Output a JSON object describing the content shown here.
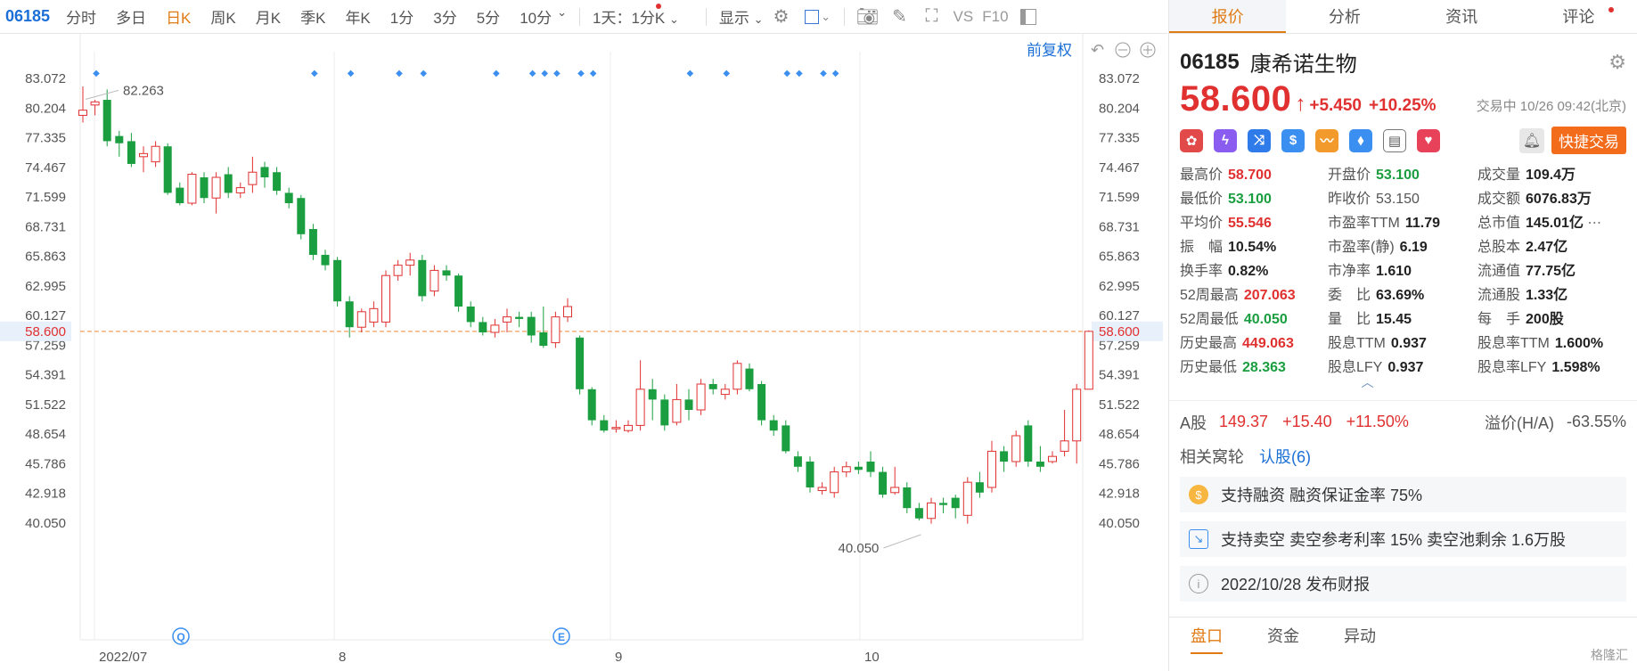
{
  "toolbar": {
    "code": "06185",
    "items": [
      {
        "label": "分时",
        "active": false
      },
      {
        "label": "多日",
        "active": false
      },
      {
        "label": "日K",
        "active": true
      },
      {
        "label": "周K",
        "active": false
      },
      {
        "label": "月K",
        "active": false
      },
      {
        "label": "季K",
        "active": false
      },
      {
        "label": "年K",
        "active": false
      },
      {
        "label": "1分",
        "active": false
      },
      {
        "label": "3分",
        "active": false
      },
      {
        "label": "5分",
        "active": false
      },
      {
        "label": "10分",
        "active": false
      }
    ],
    "period_select": "1天：1分K",
    "display_label": "显示",
    "vs_label": "VS",
    "f10_label": "F10",
    "restore_label": "前复权"
  },
  "chart_data": {
    "type": "candlestick",
    "y_ticks": [
      "83.072",
      "80.204",
      "77.335",
      "74.467",
      "71.599",
      "68.731",
      "65.863",
      "62.995",
      "60.127",
      "57.259",
      "54.391",
      "51.522",
      "48.654",
      "45.786",
      "42.918",
      "40.050"
    ],
    "current_price_label": "58.600",
    "high_label": "82.263",
    "low_label": "40.050",
    "x_labels": [
      "2022/07",
      "8",
      "9",
      "10"
    ],
    "event_markers": [
      "Q",
      "E"
    ],
    "candles": [
      [
        79.5,
        80.0,
        78.8,
        82.3
      ],
      [
        80.5,
        80.8,
        79.5,
        81.0
      ],
      [
        81.0,
        77.0,
        76.5,
        82.0
      ],
      [
        77.5,
        76.8,
        75.5,
        78.0
      ],
      [
        77.0,
        74.8,
        74.5,
        77.8
      ],
      [
        75.5,
        75.8,
        74.0,
        76.5
      ],
      [
        75.0,
        76.5,
        74.5,
        77.0
      ],
      [
        76.5,
        72.0,
        71.8,
        76.8
      ],
      [
        72.5,
        71.0,
        70.8,
        73.0
      ],
      [
        71.0,
        73.8,
        70.8,
        74.0
      ],
      [
        73.5,
        71.5,
        71.0,
        74.0
      ],
      [
        71.5,
        73.5,
        70.0,
        74.0
      ],
      [
        73.8,
        72.0,
        71.5,
        74.5
      ],
      [
        72.0,
        72.5,
        71.5,
        73.0
      ],
      [
        72.8,
        74.0,
        72.0,
        75.5
      ],
      [
        74.5,
        73.5,
        72.5,
        75.0
      ],
      [
        74.0,
        72.2,
        71.8,
        74.5
      ],
      [
        72.0,
        71.0,
        70.5,
        72.5
      ],
      [
        71.5,
        68.0,
        67.5,
        71.8
      ],
      [
        68.5,
        66.0,
        65.5,
        69.0
      ],
      [
        66.0,
        65.0,
        64.5,
        66.5
      ],
      [
        65.5,
        61.5,
        61.0,
        65.8
      ],
      [
        61.5,
        59.0,
        58.0,
        62.0
      ],
      [
        59.0,
        60.5,
        58.5,
        60.8
      ],
      [
        59.5,
        60.8,
        59.0,
        61.5
      ],
      [
        59.5,
        64.0,
        59.0,
        64.5
      ],
      [
        64.0,
        65.0,
        63.5,
        65.5
      ],
      [
        65.0,
        65.5,
        64.0,
        66.2
      ],
      [
        65.5,
        62.0,
        61.5,
        66.0
      ],
      [
        62.5,
        64.5,
        62.0,
        65.0
      ],
      [
        64.5,
        64.0,
        63.5,
        65.0
      ],
      [
        64.0,
        61.0,
        60.5,
        64.2
      ],
      [
        61.0,
        59.5,
        59.0,
        61.5
      ],
      [
        59.5,
        58.5,
        58.2,
        60.0
      ],
      [
        58.5,
        59.2,
        58.0,
        59.8
      ],
      [
        59.5,
        60.0,
        58.5,
        60.8
      ],
      [
        60.0,
        59.8,
        59.0,
        60.5
      ],
      [
        60.0,
        58.2,
        57.5,
        60.5
      ],
      [
        58.5,
        57.2,
        57.0,
        61.0
      ],
      [
        57.5,
        60.0,
        57.0,
        60.5
      ],
      [
        60.0,
        61.0,
        59.5,
        61.8
      ],
      [
        58.0,
        53.0,
        52.5,
        58.2
      ],
      [
        53.0,
        50.0,
        49.5,
        53.2
      ],
      [
        50.0,
        49.0,
        48.8,
        50.5
      ],
      [
        49.2,
        49.3,
        48.8,
        50.0
      ],
      [
        49.0,
        49.5,
        48.8,
        50.0
      ],
      [
        49.5,
        53.0,
        49.0,
        55.8
      ],
      [
        53.0,
        52.0,
        50.0,
        54.0
      ],
      [
        52.0,
        49.5,
        49.0,
        52.5
      ],
      [
        49.8,
        52.0,
        49.5,
        53.5
      ],
      [
        52.0,
        51.0,
        50.0,
        53.0
      ],
      [
        51.0,
        53.5,
        50.5,
        54.0
      ],
      [
        53.5,
        53.0,
        52.5,
        54.0
      ],
      [
        52.5,
        53.0,
        52.0,
        53.5
      ],
      [
        53.0,
        55.5,
        52.5,
        55.8
      ],
      [
        55.0,
        53.0,
        52.8,
        55.5
      ],
      [
        53.5,
        50.0,
        49.5,
        53.8
      ],
      [
        50.0,
        49.0,
        48.5,
        50.5
      ],
      [
        49.5,
        47.0,
        46.8,
        50.0
      ],
      [
        46.5,
        45.5,
        45.0,
        47.0
      ],
      [
        46.0,
        43.5,
        43.0,
        46.5
      ],
      [
        43.2,
        43.5,
        42.8,
        44.0
      ],
      [
        43.0,
        45.0,
        42.5,
        45.5
      ],
      [
        45.0,
        45.5,
        44.5,
        46.0
      ],
      [
        45.5,
        45.2,
        44.8,
        46.0
      ],
      [
        46.0,
        45.0,
        44.5,
        47.0
      ],
      [
        45.0,
        42.8,
        42.5,
        45.5
      ],
      [
        43.0,
        43.5,
        42.8,
        45.5
      ],
      [
        43.5,
        41.5,
        41.0,
        44.0
      ],
      [
        41.5,
        40.5,
        40.3,
        42.0
      ],
      [
        40.5,
        42.0,
        40.0,
        42.5
      ],
      [
        42.0,
        41.8,
        41.0,
        42.5
      ],
      [
        42.5,
        41.5,
        40.5,
        42.8
      ],
      [
        40.8,
        44.0,
        40.0,
        44.5
      ],
      [
        44.0,
        43.0,
        42.5,
        45.0
      ],
      [
        43.5,
        47.0,
        43.0,
        48.0
      ],
      [
        47.0,
        46.0,
        45.0,
        47.5
      ],
      [
        46.0,
        48.5,
        45.5,
        49.0
      ],
      [
        49.5,
        46.0,
        45.5,
        50.0
      ],
      [
        46.0,
        45.5,
        45.0,
        47.5
      ],
      [
        46.0,
        46.5,
        45.8,
        47.0
      ],
      [
        47.0,
        48.0,
        46.5,
        51.0
      ],
      [
        48.0,
        53.0,
        45.8,
        53.5
      ],
      [
        53.0,
        58.6,
        53.0,
        58.7
      ]
    ]
  },
  "stock": {
    "code": "06185",
    "name": "康希诺生物",
    "price": "58.600",
    "change": "+5.450",
    "change_pct": "+10.25%",
    "status": "交易中 10/26 09:42(北京)",
    "quick_trade": "快捷交易"
  },
  "panel_tabs": [
    "报价",
    "分析",
    "资讯",
    "评论"
  ],
  "stats": [
    {
      "label": "最高价",
      "value": "58.700",
      "color": "red"
    },
    {
      "label": "开盘价",
      "value": "53.100",
      "color": "green"
    },
    {
      "label": "成交量",
      "value": "109.4万",
      "color": ""
    },
    {
      "label": "最低价",
      "value": "53.100",
      "color": "green"
    },
    {
      "label": "昨收价",
      "value": "53.150",
      "color": "plain"
    },
    {
      "label": "成交额",
      "value": "6076.83万",
      "color": ""
    },
    {
      "label": "平均价",
      "value": "55.546",
      "color": "red"
    },
    {
      "label": "市盈率TTM",
      "value": "11.79",
      "color": ""
    },
    {
      "label": "总市值",
      "value": "145.01亿",
      "color": ""
    },
    {
      "label": "振　幅",
      "value": "10.54%",
      "color": ""
    },
    {
      "label": "市盈率(静)",
      "value": "6.19",
      "color": ""
    },
    {
      "label": "总股本",
      "value": "2.47亿",
      "color": ""
    },
    {
      "label": "换手率",
      "value": "0.82%",
      "color": ""
    },
    {
      "label": "市净率",
      "value": "1.610",
      "color": ""
    },
    {
      "label": "流通值",
      "value": "77.75亿",
      "color": ""
    },
    {
      "label": "52周最高",
      "value": "207.063",
      "color": "red"
    },
    {
      "label": "委　比",
      "value": "63.69%",
      "color": ""
    },
    {
      "label": "流通股",
      "value": "1.33亿",
      "color": ""
    },
    {
      "label": "52周最低",
      "value": "40.050",
      "color": "green"
    },
    {
      "label": "量　比",
      "value": "15.45",
      "color": ""
    },
    {
      "label": "每　手",
      "value": "200股",
      "color": ""
    },
    {
      "label": "历史最高",
      "value": "449.063",
      "color": "red"
    },
    {
      "label": "股息TTM",
      "value": "0.937",
      "color": ""
    },
    {
      "label": "股息率TTM",
      "value": "1.600%",
      "color": ""
    },
    {
      "label": "历史最低",
      "value": "28.363",
      "color": "green"
    },
    {
      "label": "股息LFY",
      "value": "0.937",
      "color": ""
    },
    {
      "label": "股息率LFY",
      "value": "1.598%",
      "color": ""
    }
  ],
  "ashare": {
    "label": "A股",
    "price": "149.37",
    "change": "+15.40",
    "pct": "+11.50%",
    "premium_label": "溢价(H/A)",
    "premium": "-63.55%"
  },
  "related": {
    "label": "相关窝轮",
    "link": "认股(6)"
  },
  "info": [
    {
      "text": "支持融资 融资保证金率 75%",
      "icon": "coin-icon"
    },
    {
      "text": "支持卖空 卖空参考利率 15% 卖空池剩余 1.6万股",
      "icon": "chart-icon"
    },
    {
      "text": "2022/10/28  发布财报",
      "icon": "info-icon"
    }
  ],
  "bottom_tabs": [
    "盘口",
    "资金",
    "异动"
  ],
  "watermark": "格隆汇"
}
